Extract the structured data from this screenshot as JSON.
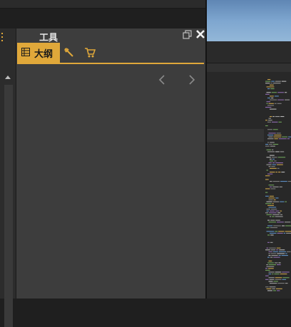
{
  "panel": {
    "title": "工具",
    "tabs": [
      {
        "label": "大纲",
        "icon": "outline-grid-icon",
        "active": true
      },
      {
        "label": "",
        "icon": "tools-icon",
        "active": false
      },
      {
        "label": "",
        "icon": "cart-icon",
        "active": false
      }
    ],
    "nav": {
      "prev_icon": "chevron-left-icon",
      "next_icon": "chevron-right-icon"
    }
  },
  "colors": {
    "accent": "#e0a83a",
    "panel_bg": "#3d3d3d",
    "editor_bg": "#282828"
  }
}
